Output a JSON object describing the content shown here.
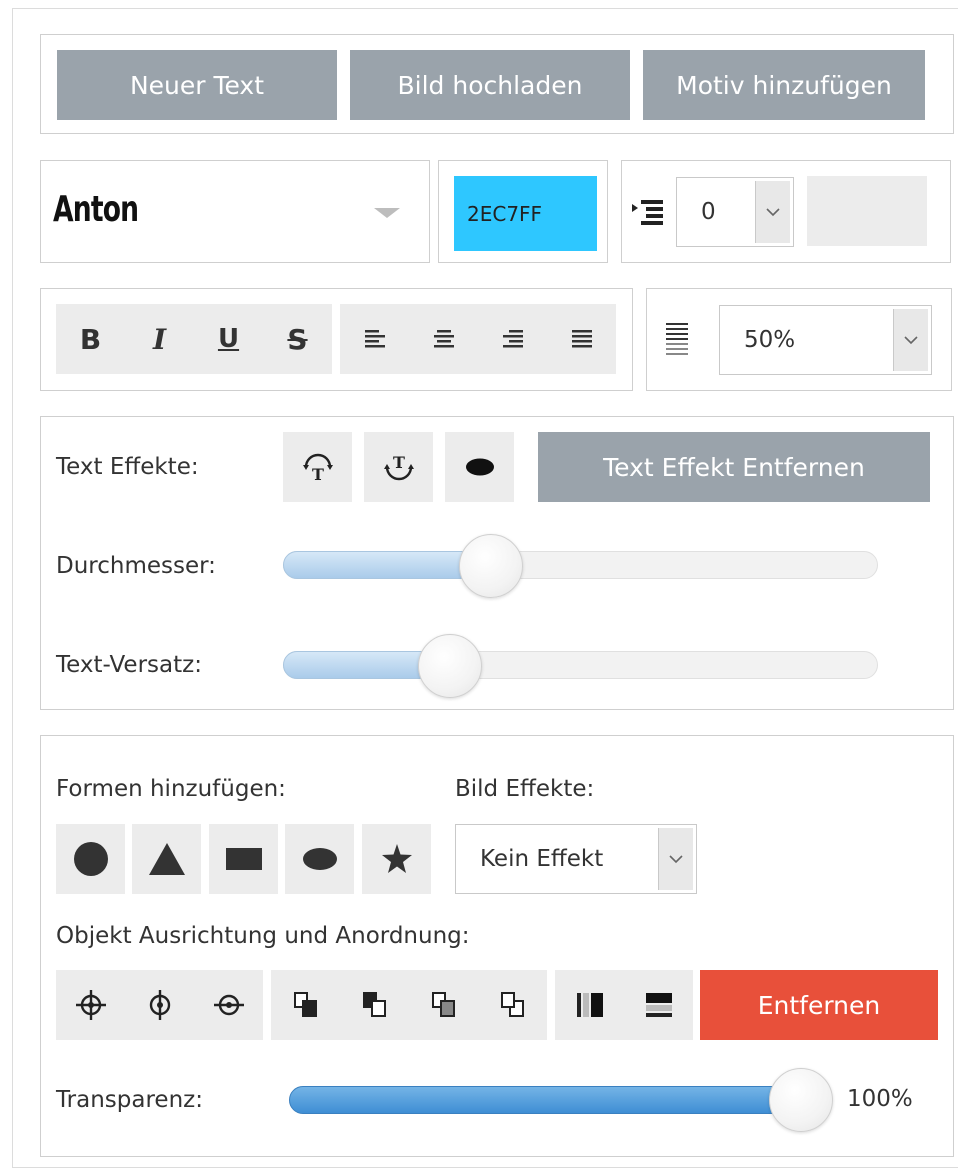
{
  "top_buttons": [
    "Neuer Text",
    "Bild hochladen",
    "Motiv hinzufügen"
  ],
  "font": {
    "value": "Anton"
  },
  "color": {
    "value": "2EC7FF",
    "swatch": "#2EC7FF"
  },
  "indent": {
    "value": "0"
  },
  "format": {
    "items": [
      "B",
      "I",
      "U",
      "S"
    ]
  },
  "line_height": {
    "value": "50%"
  },
  "text_effects": {
    "label": "Text Effekte:",
    "remove_label": "Text Effekt Entfernen",
    "icons": [
      "arc-up-icon",
      "arc-down-icon",
      "ellipse-icon"
    ]
  },
  "diameter": {
    "label": "Durchmesser:",
    "level": 0.35
  },
  "text_offset": {
    "label": "Text-Versatz:",
    "level": 0.28
  },
  "shapes": {
    "label": "Formen hinzufügen:",
    "icons": [
      "circle-icon",
      "triangle-icon",
      "rectangle-icon",
      "ellipse-icon",
      "star-icon"
    ]
  },
  "image_effects": {
    "label": "Bild Effekte:",
    "value": "Kein Effekt"
  },
  "arrange": {
    "label": "Objekt Ausrichtung und Anordnung:",
    "remove_label": "Entfernen",
    "remove_color": "#E8503A"
  },
  "transparency": {
    "label": "Transparenz:",
    "value_text": "100%",
    "level": 1.0
  }
}
